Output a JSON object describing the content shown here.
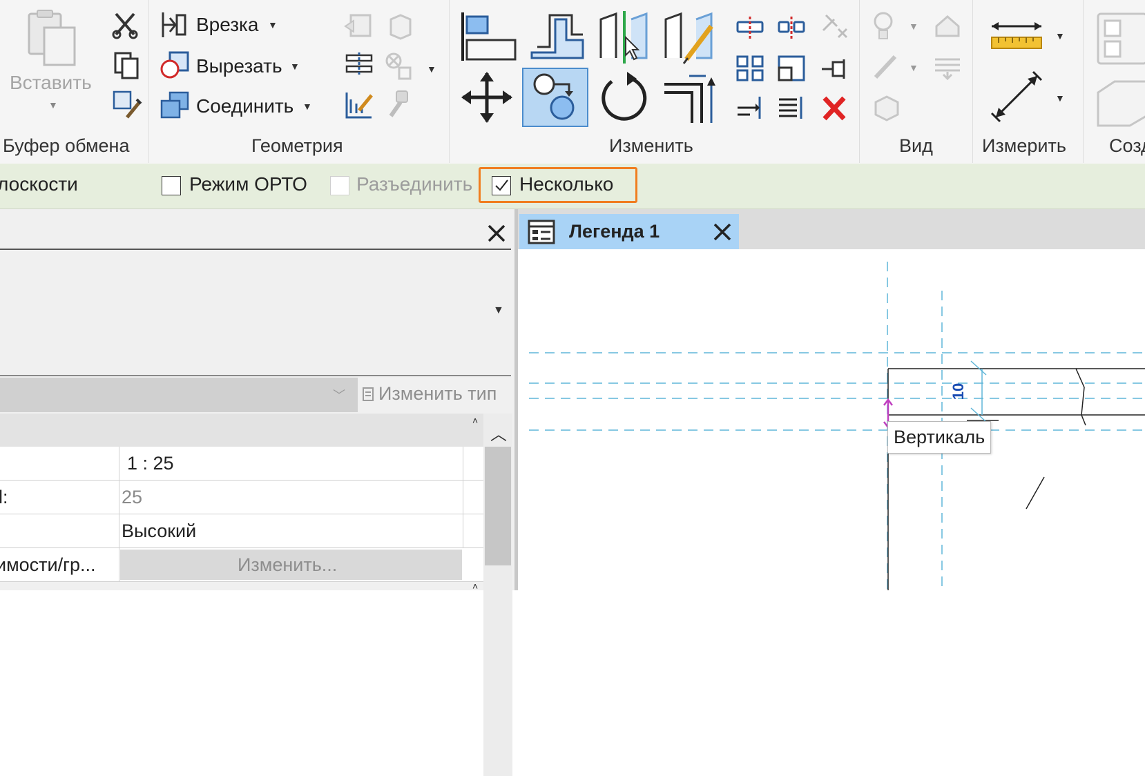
{
  "ribbon": {
    "clipboard": {
      "label": "Буфер обмена",
      "paste": "Вставить"
    },
    "geometry": {
      "label": "Геометрия",
      "cope": "Врезка",
      "cut": "Вырезать",
      "join": "Соединить"
    },
    "modify": {
      "label": "Изменить"
    },
    "view": {
      "label": "Вид"
    },
    "measure": {
      "label": "Измерить"
    },
    "create": {
      "label": "Созд"
    }
  },
  "options_bar": {
    "planes_fragment": "лоскости",
    "ortho": {
      "label": "Режим ОРТО",
      "checked": false
    },
    "disjoin": {
      "label": "Разъединить",
      "checked": false,
      "enabled": false
    },
    "multiple": {
      "label": "Несколько",
      "checked": true
    }
  },
  "properties": {
    "edit_type": "Изменить тип",
    "rows": [
      {
        "name": "",
        "value": "1 : 25"
      },
      {
        "name": "l:",
        "value": "25"
      },
      {
        "name": "",
        "value": "Высокий"
      },
      {
        "name": "имости/гр...",
        "value": "Изменить..."
      }
    ]
  },
  "view": {
    "tab_title": "Легенда 1",
    "dimension_value": "10",
    "tooltip": "Вертикаль"
  },
  "colors": {
    "accent_orange": "#f07d1f",
    "tab_blue": "#a9d3f6",
    "options_green": "#e6eedd",
    "dimension_blue": "#1a4db3",
    "snap_magenta": "#c040c0",
    "guide_cyan": "#5fb6d8"
  }
}
